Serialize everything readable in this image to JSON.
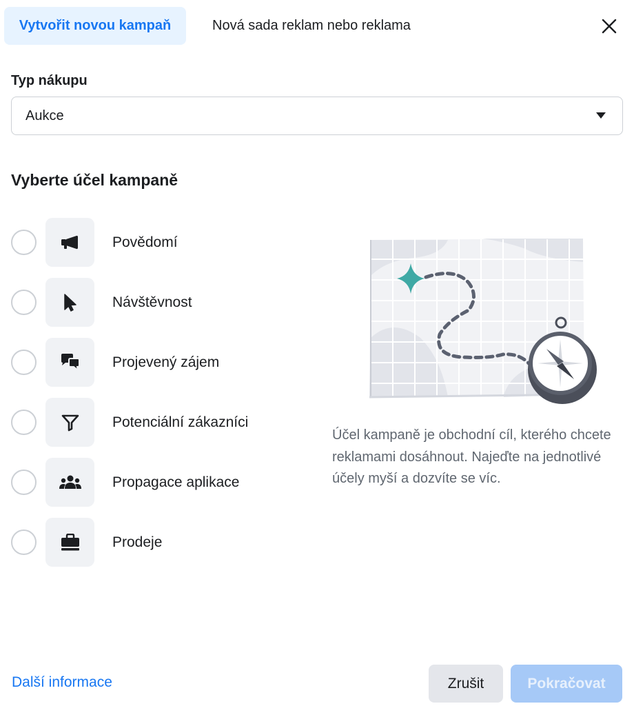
{
  "tabs": [
    {
      "label": "Vytvořit novou kampaň",
      "active": true
    },
    {
      "label": "Nová sada reklam nebo reklama",
      "active": false
    }
  ],
  "close_icon": "close-icon",
  "purchase_type": {
    "label": "Typ nákupu",
    "selected": "Aukce"
  },
  "objective": {
    "heading": "Vyberte účel kampaně",
    "options": [
      {
        "label": "Povědomí",
        "icon": "megaphone-icon"
      },
      {
        "label": "Návštěvnost",
        "icon": "cursor-icon"
      },
      {
        "label": "Projevený zájem",
        "icon": "chat-bubbles-icon"
      },
      {
        "label": "Potenciální zákazníci",
        "icon": "funnel-icon"
      },
      {
        "label": "Propagace aplikace",
        "icon": "people-icon"
      },
      {
        "label": "Prodeje",
        "icon": "briefcase-icon"
      }
    ],
    "description": "Účel kampaně je obchodní cíl, kterého chcete reklamami dosáhnout. Najeďte na jednotlivé účely myší a dozvíte se víc."
  },
  "footer": {
    "learn_more": "Další informace",
    "cancel": "Zrušit",
    "continue": "Pokračovat"
  },
  "colors": {
    "accent": "#1877f2",
    "accent_light": "#e7f3ff",
    "disabled_button": "#a6c9f7",
    "teal_star": "#3fa9a5"
  }
}
